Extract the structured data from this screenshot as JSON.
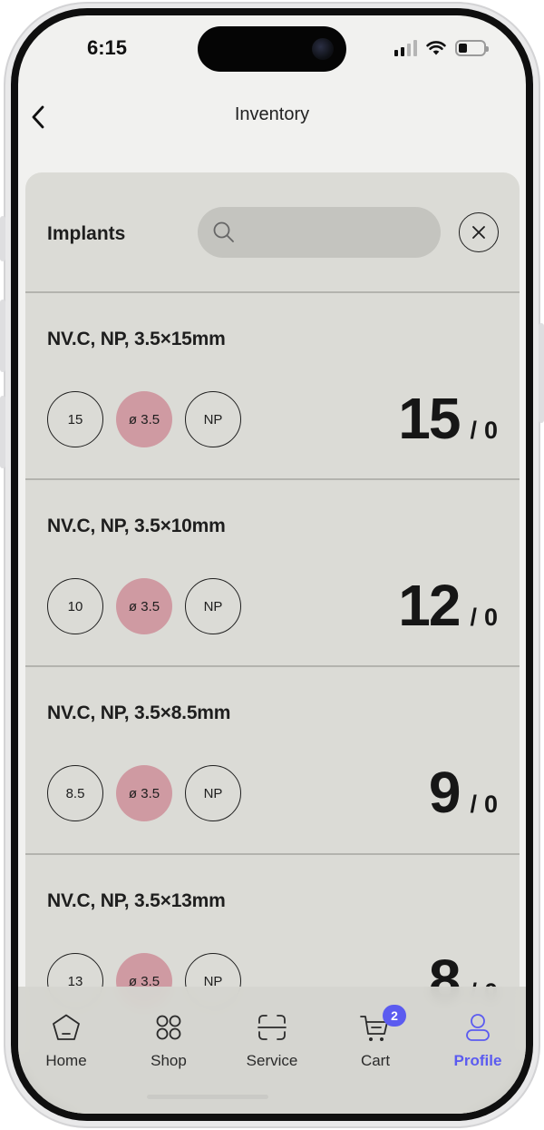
{
  "status_bar": {
    "time": "6:15"
  },
  "nav": {
    "title": "Inventory",
    "back_icon": "chevron-left-icon"
  },
  "header": {
    "title": "Implants",
    "search_placeholder": "",
    "search_value": ""
  },
  "colors": {
    "accent_chip": "#cf9aa2",
    "active_tab": "#5b5bf0",
    "panel_bg": "#dbdbd6"
  },
  "items": [
    {
      "name": "NV.C, NP, 3.5×15mm",
      "length": "15",
      "diameter": "ø 3.5",
      "platform": "NP",
      "qty": "15",
      "qty_sep": "/",
      "reserved": "0"
    },
    {
      "name": "NV.C, NP, 3.5×10mm",
      "length": "10",
      "diameter": "ø 3.5",
      "platform": "NP",
      "qty": "12",
      "qty_sep": "/",
      "reserved": "0"
    },
    {
      "name": "NV.C, NP, 3.5×8.5mm",
      "length": "8.5",
      "diameter": "ø 3.5",
      "platform": "NP",
      "qty": "9",
      "qty_sep": "/",
      "reserved": "0"
    },
    {
      "name": "NV.C, NP, 3.5×13mm",
      "length": "13",
      "diameter": "ø 3.5",
      "platform": "NP",
      "qty": "8",
      "qty_sep": "/",
      "reserved": "0"
    }
  ],
  "tabs": [
    {
      "label": "Home",
      "icon": "home-pentagon-icon"
    },
    {
      "label": "Shop",
      "icon": "grid-icon"
    },
    {
      "label": "Service",
      "icon": "scan-icon"
    },
    {
      "label": "Cart",
      "icon": "cart-icon",
      "badge": "2"
    },
    {
      "label": "Profile",
      "icon": "person-icon",
      "active": true
    }
  ]
}
